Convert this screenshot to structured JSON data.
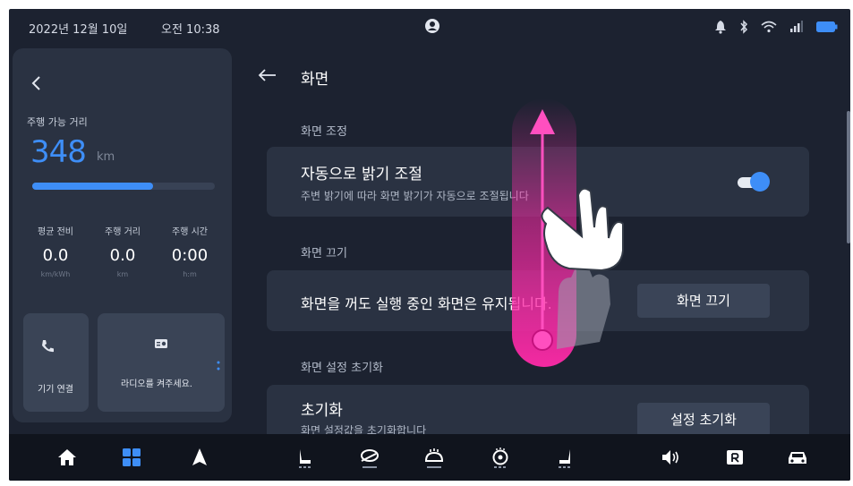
{
  "status": {
    "date": "2022년 12월 10일",
    "time": "오전 10:38",
    "icons": [
      "user-icon",
      "bell-icon",
      "bluetooth-icon",
      "wifi-icon",
      "signal-icon",
      "battery-icon"
    ]
  },
  "left_panel": {
    "range_label": "주행 가능 거리",
    "range_value": "348",
    "range_unit": "km",
    "range_level_fraction": 0.66,
    "stats": [
      {
        "label": "평균 전비",
        "value": "0.0",
        "unit": "km/kWh"
      },
      {
        "label": "주행 거리",
        "value": "0.0",
        "unit": "km"
      },
      {
        "label": "주행 시간",
        "value": "0:00",
        "unit": "h:m"
      }
    ],
    "tiles": {
      "call_label": "기기 연결",
      "radio_label": "라디오를 켜주세요."
    }
  },
  "settings": {
    "title": "화면",
    "sections": [
      {
        "label": "화면 조정",
        "title": "자동으로 밝기 조절",
        "subtitle": "주변 밝기에 따라 화면 밝기가 자동으로 조절됩니다",
        "toggle_on": true
      },
      {
        "label": "화면 끄기",
        "text": "화면을 꺼도 실행 중인 화면은 유지됩니다.",
        "button": "화면 끄기"
      },
      {
        "label": "화면 설정 초기화",
        "title": "초기화",
        "subtitle": "화면 설정값을 초기화합니다",
        "button": "설정 초기화"
      }
    ]
  },
  "dock": {
    "icons": [
      "home-icon",
      "apps-icon",
      "navigation-icon",
      "seat-driver-icon",
      "air-direction-icon",
      "defrost-icon",
      "steering-heat-icon",
      "seat-passenger-icon",
      "volume-icon",
      "rear-camera-icon",
      "car-icon"
    ]
  },
  "colors": {
    "accent": "#3e8ef7",
    "gesture": "#ff2aa8",
    "background": "#1c2230",
    "card": "#2a3242"
  }
}
